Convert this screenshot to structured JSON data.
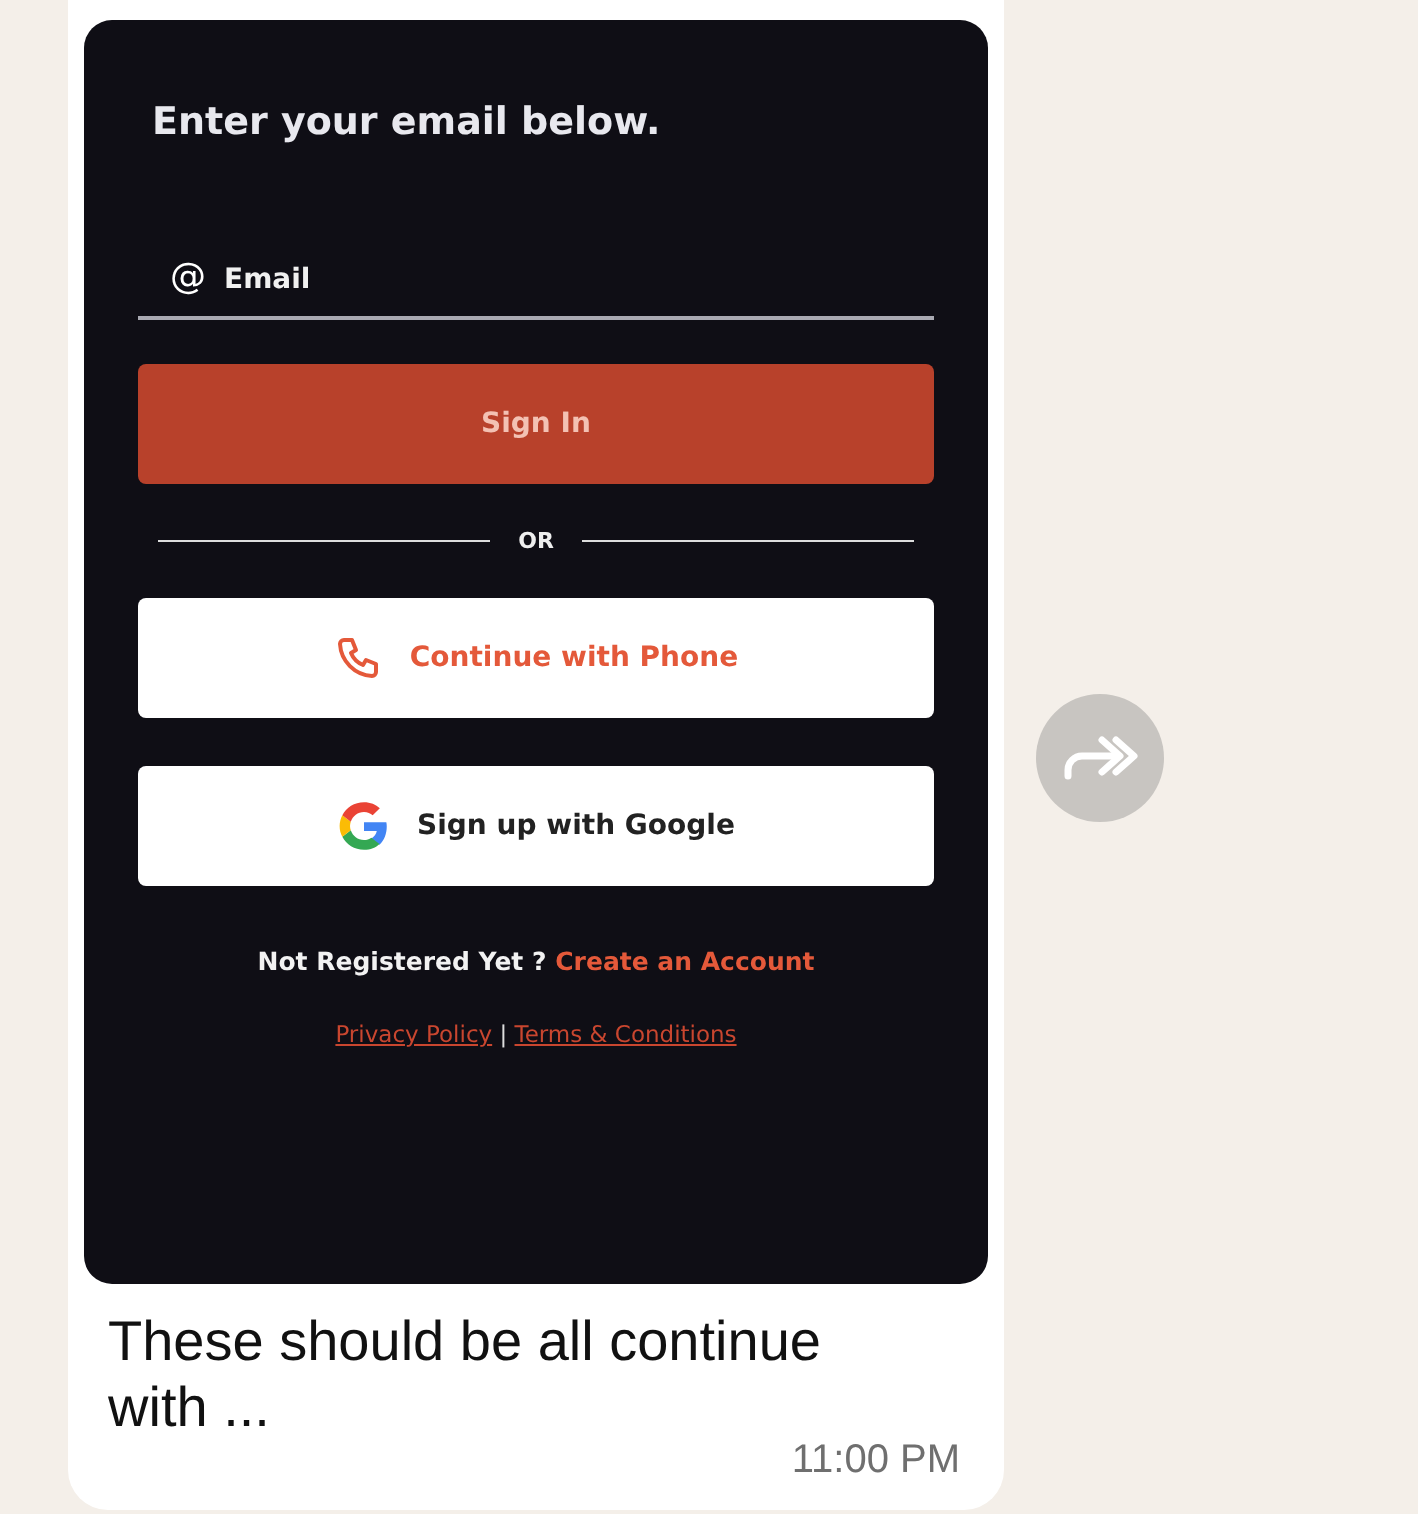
{
  "message": {
    "screenshot": {
      "heading": "Enter your email below.",
      "email_field": {
        "icon": "@",
        "placeholder": "Email"
      },
      "sign_in_button": "Sign In",
      "divider": "OR",
      "buttons": [
        {
          "kind": "phone",
          "label": "Continue with Phone"
        },
        {
          "kind": "google",
          "label": "Sign up with Google"
        }
      ],
      "register_prompt": "Not Registered Yet ?",
      "register_link": "Create an Account",
      "links": [
        "Privacy Policy",
        "Terms & Conditions"
      ],
      "link_separator": "|"
    },
    "text": "These should be all continue with ...",
    "time": "11:00 PM"
  }
}
